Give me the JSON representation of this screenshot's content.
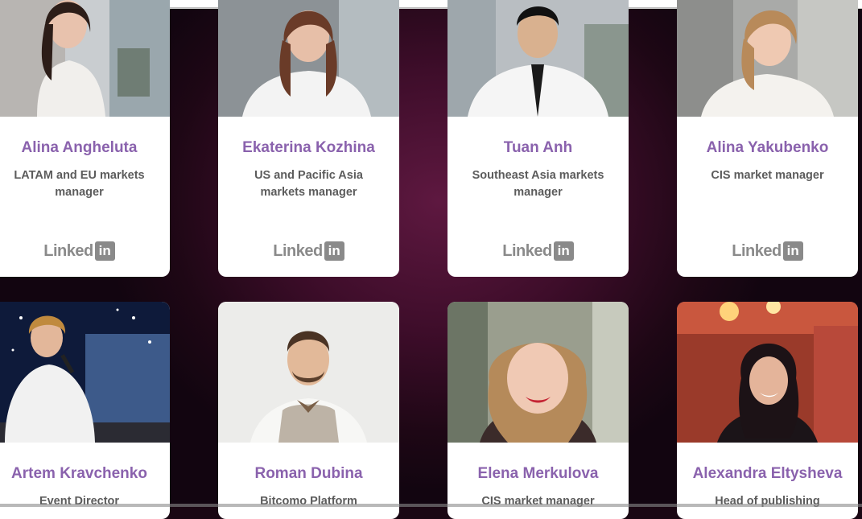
{
  "browser": {
    "address": ""
  },
  "team": [
    {
      "name": "Alina Angheluta",
      "role": "LATAM and EU markets manager",
      "linkedin": "Linked",
      "linkedin_in": "in"
    },
    {
      "name": "Ekaterina Kozhina",
      "role": "US and Pacific Asia markets manager",
      "linkedin": "Linked",
      "linkedin_in": "in"
    },
    {
      "name": "Tuan Anh",
      "role": "Southeast Asia markets manager",
      "linkedin": "Linked",
      "linkedin_in": "in"
    },
    {
      "name": "Alina Yakubenko",
      "role": "CIS market manager",
      "linkedin": "Linked",
      "linkedin_in": "in"
    },
    {
      "name": "Artem Kravchenko",
      "role": "Event Director"
    },
    {
      "name": "Roman Dubina",
      "role": "Bitcomo Platform"
    },
    {
      "name": "Elena Merkulova",
      "role": "CIS market manager"
    },
    {
      "name": "Alexandra Eltysheva",
      "role": "Head of publishing"
    }
  ],
  "colors": {
    "name": "#8a62ad",
    "role": "#5c5c5c",
    "linkedin": "#8a8a8a",
    "background": "#3e0d2a"
  }
}
